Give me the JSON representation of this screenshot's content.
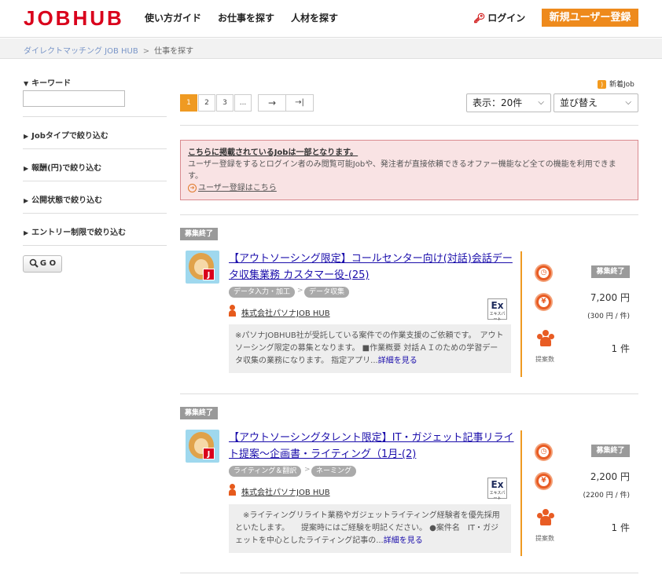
{
  "header": {
    "logo": "JOBHUB",
    "nav": [
      "使い方ガイド",
      "お仕事を探す",
      "人材を探す"
    ],
    "login": "ログイン",
    "register": "新規ユーザー登録"
  },
  "breadcrumb": {
    "home": "ダイレクトマッチング JOB HUB",
    "sep": ">",
    "current": "仕事を探す"
  },
  "sidebar": {
    "keyword_label": "キーワード",
    "keyword_value": "",
    "filters": [
      "Jobタイプで絞り込む",
      "報酬(円)で絞り込む",
      "公開状態で絞り込む",
      "エントリー制限で絞り込む"
    ],
    "go": "G O"
  },
  "rss_label": "新着Job",
  "pagination": {
    "pages": [
      "1",
      "2",
      "3",
      "..."
    ],
    "next": "→",
    "last": "→|",
    "active": "1"
  },
  "display_select": "表示：20件",
  "sort_select": "並び替え",
  "notice": {
    "title": "こちらに掲載されているJobは一部となります。",
    "body": "ユーザー登録をするとログイン者のみ閲覧可能Jobや、発注者が直接依頼できるオファー機能など全ての機能を利用できます。",
    "link": "ユーザー登録はこちら"
  },
  "jobs": [
    {
      "status": "募集終了",
      "title": "【アウトソーシング限定】コールセンター向け(対話)会話データ収集業務 カスタマー役-(25)",
      "categories": [
        "データ入力・加工",
        "データ収集"
      ],
      "company": "株式会社パソナJOB HUB",
      "badge": "Ex",
      "badge_sub": "エキスパート",
      "description": "※パソナJOBHUB社が受託している案件での作業支援のご依頼です。　アウトソーシング限定の募集となります。 ■作業概要 対話ＡＩのための学習データ収集の業務になります。 指定アプリ...",
      "more": "詳細を見る",
      "deadline_status": "募集終了",
      "price": "7,200 円",
      "unit_price": "(300 円 / 件)",
      "proposals": "1 件",
      "proposals_label": "提案数"
    },
    {
      "status": "募集終了",
      "title": "【アウトソーシングタレント限定】IT・ガジェット記事リライト提案～企画書・ライティング（1月-(2)",
      "categories": [
        "ライティング＆翻訳",
        "ネーミング"
      ],
      "company": "株式会社パソナJOB HUB",
      "badge": "Ex",
      "badge_sub": "エキスパート",
      "description": "　※ライティングリライト業務やガジェットライティング経験者を優先採用といたします。　　提案時にはご経験を明記ください。 ●案件名　IT・ガジェットを中心としたライティング記事の...",
      "more": "詳細を見る",
      "deadline_status": "募集終了",
      "price": "2,200 円",
      "unit_price": "(2200 円 / 件)",
      "proposals": "1 件",
      "proposals_label": "提案数"
    }
  ],
  "colors": {
    "brand_red": "#d9001b",
    "accent_orange": "#ee8a1c",
    "link": "#1a0dab",
    "notice_bg": "#f9e3e4"
  }
}
